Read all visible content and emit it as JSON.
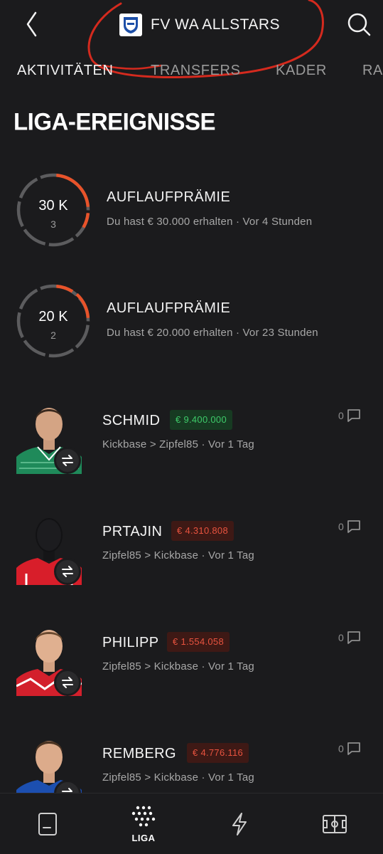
{
  "header": {
    "team_name": "FV WA ALLSTARS",
    "back_icon": "chevron-left-icon",
    "search_icon": "search-icon",
    "crest_icon": "team-crest-icon"
  },
  "tabs": [
    {
      "label": "AKTIVITÄTEN",
      "active": true
    },
    {
      "label": "TRANSFERS",
      "active": false
    },
    {
      "label": "KADER",
      "active": false
    },
    {
      "label": "RA",
      "active": false
    }
  ],
  "section_title": "LIGA-EREIGNISSE",
  "bonuses": [
    {
      "amount": "30 K",
      "count": "3",
      "title": "AUFLAUFPRÄMIE",
      "subtitle": "Du hast € 30.000 erhalten · Vor 4 Stunden"
    },
    {
      "amount": "20 K",
      "count": "2",
      "title": "AUFLAUFPRÄMIE",
      "subtitle": "Du hast € 20.000 erhalten · Vor 23 Stunden"
    }
  ],
  "transfers": [
    {
      "name": "SCHMID",
      "price": "€ 9.400.000",
      "trend": "up",
      "subtitle": "Kickbase > Zipfel85 · Vor 1 Tag",
      "comments": "0"
    },
    {
      "name": "PRTAJIN",
      "price": "€ 4.310.808",
      "trend": "down",
      "subtitle": "Zipfel85 > Kickbase · Vor 1 Tag",
      "comments": "0"
    },
    {
      "name": "PHILIPP",
      "price": "€ 1.554.058",
      "trend": "down",
      "subtitle": "Zipfel85 > Kickbase · Vor 1 Tag",
      "comments": "0"
    },
    {
      "name": "REMBERG",
      "price": "€ 4.776.116",
      "trend": "down",
      "subtitle": "Zipfel85 > Kickbase · Vor 1 Tag",
      "comments": "0"
    }
  ],
  "bottom_nav": [
    {
      "icon": "document-icon",
      "label": ""
    },
    {
      "icon": "league-dots-icon",
      "label": "LIGA",
      "active": true
    },
    {
      "icon": "lightning-icon",
      "label": ""
    },
    {
      "icon": "pitch-icon",
      "label": ""
    }
  ],
  "colors": {
    "background": "#1b1b1d",
    "accent_orange": "#e8532a",
    "price_up": "#3ecb6a",
    "price_down": "#e8533f",
    "annotation_red": "#d42a1e"
  }
}
